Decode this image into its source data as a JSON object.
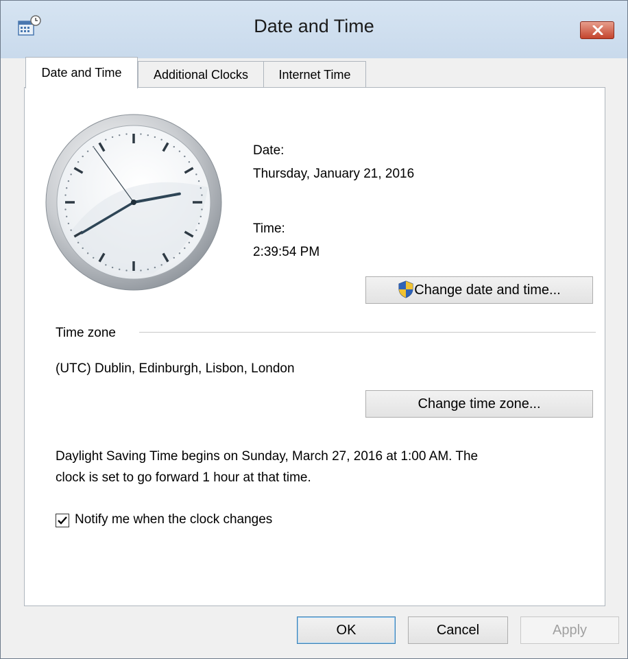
{
  "window": {
    "title": "Date and Time",
    "close_label": "close"
  },
  "tabs": [
    {
      "label": "Date and Time",
      "active": true
    },
    {
      "label": "Additional Clocks",
      "active": false
    },
    {
      "label": "Internet Time",
      "active": false
    }
  ],
  "date_section": {
    "date_label": "Date:",
    "date_value": "Thursday, January 21, 2016",
    "time_label": "Time:",
    "time_value": "2:39:54 PM",
    "change_button_label": "Change date and time..."
  },
  "clock": {
    "hours": 2,
    "minutes": 39,
    "seconds": 54
  },
  "timezone": {
    "section_label": "Time zone",
    "value": "(UTC) Dublin, Edinburgh, Lisbon, London",
    "change_button_label": "Change time zone..."
  },
  "dst": {
    "line1": "Daylight Saving Time begins on Sunday, March 27, 2016 at 1:00 AM. The",
    "line2": "clock is set to go forward 1 hour at that time."
  },
  "notify": {
    "label": "Notify me when the clock changes",
    "checked": true
  },
  "footer": {
    "ok_label": "OK",
    "cancel_label": "Cancel",
    "apply_label": "Apply",
    "apply_enabled": false
  },
  "icons": {
    "window_icon": "calendar-clock-icon",
    "shield": "uac-shield-icon",
    "close": "close-icon",
    "check": "checkmark-icon"
  },
  "colors": {
    "close_button": "#c4442d",
    "titlebar": "#cfdfef",
    "default_button_border": "#3c7fb1"
  }
}
